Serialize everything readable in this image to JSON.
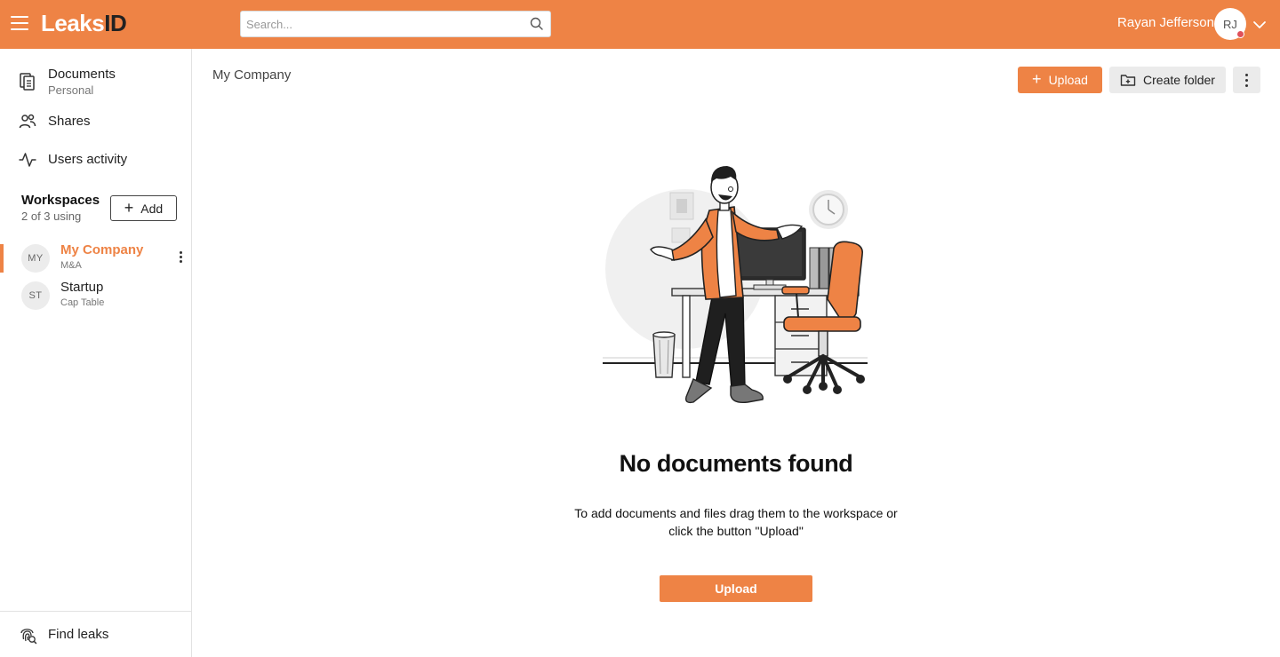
{
  "app": {
    "logo_part1": "Leaks",
    "logo_part2": "ID"
  },
  "header": {
    "search_placeholder": "Search...",
    "user_name": "Rayan Jefferson",
    "user_initials": "RJ"
  },
  "sidebar": {
    "nav": {
      "documents_label": "Documents",
      "documents_sub": "Personal",
      "shares_label": "Shares",
      "activity_label": "Users activity"
    },
    "workspaces": {
      "title": "Workspaces",
      "count": "2 of 3 using",
      "add_label": "Add",
      "items": [
        {
          "initials": "MY",
          "name": "My Company",
          "desc": "M&A",
          "active": true
        },
        {
          "initials": "ST",
          "name": "Startup",
          "desc": "Cap Table",
          "active": false
        }
      ]
    },
    "bottom": {
      "find_leaks_label": "Find leaks"
    }
  },
  "main": {
    "title": "My Company",
    "upload_label": "Upload",
    "create_folder_label": "Create folder",
    "empty_title": "No documents found",
    "empty_line1": "To add documents and files drag them to the workspace or",
    "empty_line2": "click the button \"Upload\"",
    "empty_upload_label": "Upload"
  },
  "colors": {
    "accent": "#ee8345",
    "status_dot": "#e0505a"
  },
  "icons": [
    "menu-icon",
    "search-icon",
    "chevron-down-icon",
    "documents-icon",
    "shares-icon",
    "activity-icon",
    "plus-icon",
    "more-vertical-icon",
    "folder-plus-icon",
    "fingerprint-icon"
  ]
}
